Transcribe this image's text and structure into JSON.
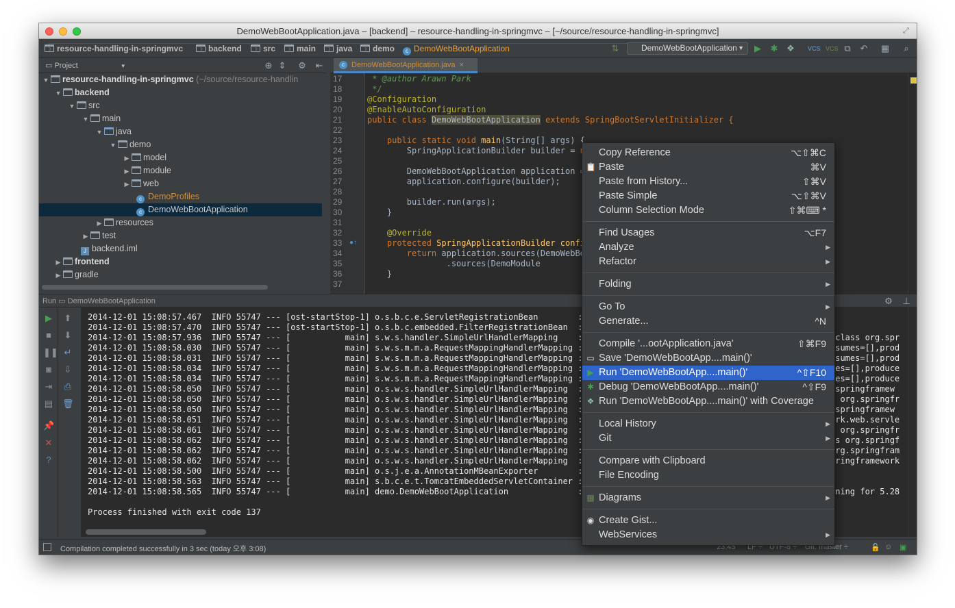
{
  "window": {
    "title": "DemoWebBootApplication.java – [backend] – resource-handling-in-springmvc – [~/source/resource-handling-in-springmvc]"
  },
  "navbar": {
    "breadcrumbs": [
      "resource-handling-in-springmvc",
      "backend",
      "src",
      "main",
      "java",
      "demo",
      "DemoWebBootApplication"
    ],
    "run_config": "DemoWebBootApplication"
  },
  "project": {
    "header_label": "Project",
    "tree": [
      {
        "label": "resource-handling-in-springmvc",
        "suffix": " (~/source/resource-handlin"
      },
      {
        "label": "backend"
      },
      {
        "label": "src"
      },
      {
        "label": "main"
      },
      {
        "label": "java"
      },
      {
        "label": "demo"
      },
      {
        "label": "model"
      },
      {
        "label": "module"
      },
      {
        "label": "web"
      },
      {
        "label": "DemoProfiles"
      },
      {
        "label": "DemoWebBootApplication"
      },
      {
        "label": "resources"
      },
      {
        "label": "test"
      },
      {
        "label": "backend.iml"
      },
      {
        "label": "frontend"
      },
      {
        "label": "gradle"
      }
    ]
  },
  "editor": {
    "tab_label": "DemoWebBootApplication.java",
    "line_numbers": [
      "17",
      "18",
      "19",
      "20",
      "21",
      "22",
      "23",
      "24",
      "25",
      "26",
      "27",
      "28",
      "29",
      "30",
      "31",
      "32",
      "33",
      "34",
      "35",
      "36",
      "37"
    ],
    "lines": {
      "l17": " * @author Arawn Park",
      "l18": " */",
      "l19": "@Configuration",
      "l20": "@EnableAutoConfiguration",
      "l21a": "public class ",
      "l21b": "DemoWebBootApplication",
      "l21c": " extends SpringBootServletInitializer {",
      "l23a": "    public static void ",
      "l23b": "main",
      "l23c": "(String[] args) {",
      "l24a": "        SpringApplicationBuilder builder = ",
      "l24b": "ne",
      "l26": "        DemoWebBootApplication application = ",
      "l27": "        application.configure(builder);",
      "l29": "        builder.run(args);",
      "l30": "    }",
      "l32": "    @Override",
      "l33a": "    protected ",
      "l33b": "SpringApplicationBuilder config",
      "l34a": "        return ",
      "l34b": "application.sources(DemoWebBoo",
      "l35": "                .sources(DemoModule",
      "l36": "    }"
    }
  },
  "run": {
    "header_label": "Run",
    "config_name": "DemoWebBootApplication",
    "log": [
      {
        "left": "2014-12-01 15:08:57.467  INFO 55747 --- [ost-startStop-1] o.s.b.c.e.ServletRegistrationBean        : Ma",
        "right": ""
      },
      {
        "left": "2014-12-01 15:08:57.470  INFO 55747 --- [ost-startStop-1] o.s.b.c.embedded.FilterRegistrationBean  : Ma",
        "right": ""
      },
      {
        "left": "2014-12-01 15:08:57.936  INFO 55747 --- [           main] s.w.s.handler.SimpleUrlHandlerMapping    : Ma",
        "right": "[class org.spr"
      },
      {
        "left": "2014-12-01 15:08:58.030  INFO 55747 --- [           main] s.w.s.m.m.a.RequestMappingHandlerMapping : Ma",
        "right": "nsumes=[],prod"
      },
      {
        "left": "2014-12-01 15:08:58.031  INFO 55747 --- [           main] s.w.s.m.m.a.RequestMappingHandlerMapping : Ma",
        "right": "nsumes=[],prod"
      },
      {
        "left": "2014-12-01 15:08:58.034  INFO 55747 --- [           main] s.w.s.m.m.a.RequestMappingHandlerMapping : Ma",
        "right": "mes=[],produce"
      },
      {
        "left": "2014-12-01 15:08:58.034  INFO 55747 --- [           main] s.w.s.m.m.a.RequestMappingHandlerMapping : Ma",
        "right": "mes=[],produce"
      },
      {
        "left": "2014-12-01 15:08:58.050  INFO 55747 --- [           main] o.s.w.s.handler.SimpleUrlHandlerMapping  : Ma",
        "right": ".springframew"
      },
      {
        "left": "2014-12-01 15:08:58.050  INFO 55747 --- [           main] o.s.w.s.handler.SimpleUrlHandlerMapping  : Ma",
        "right": "s org.springfr"
      },
      {
        "left": "2014-12-01 15:08:58.050  INFO 55747 --- [           main] o.s.w.s.handler.SimpleUrlHandlerMapping  : Ma",
        "right": ".springframew"
      },
      {
        "left": "2014-12-01 15:08:58.051  INFO 55747 --- [           main] o.s.w.s.handler.SimpleUrlHandlerMapping  : Ro",
        "right": "ork.web.servle"
      },
      {
        "left": "2014-12-01 15:08:58.061  INFO 55747 --- [           main] o.s.w.s.handler.SimpleUrlHandlerMapping  : Ma",
        "right": "s org.springfr"
      },
      {
        "left": "2014-12-01 15:08:58.062  INFO 55747 --- [           main] o.s.w.s.handler.SimpleUrlHandlerMapping  : Ma",
        "right": "ss org.springf"
      },
      {
        "left": "2014-12-01 15:08:58.062  INFO 55747 --- [           main] o.s.w.s.handler.SimpleUrlHandlerMapping  : Ma",
        "right": "org.springfram"
      },
      {
        "left": "2014-12-01 15:08:58.062  INFO 55747 --- [           main] o.s.w.s.handler.SimpleUrlHandlerMapping  : Ma",
        "right": "pringframework"
      },
      {
        "left": "2014-12-01 15:08:58.500  INFO 55747 --- [           main] o.s.j.e.a.AnnotationMBeanExporter        : Re",
        "right": ""
      },
      {
        "left": "2014-12-01 15:08:58.563  INFO 55747 --- [           main] s.b.c.e.t.TomcatEmbeddedServletContainer : To",
        "right": ""
      },
      {
        "left": "2014-12-01 15:08:58.565  INFO 55747 --- [           main] demo.DemoWebBootApplication              : St",
        "right": "nning for 5.28"
      }
    ],
    "exit_message": "Process finished with exit code 137"
  },
  "status": {
    "message": "Compilation completed successfully in 3 sec (today 오후 3:08)",
    "position": "23:45",
    "line_sep": "LF ÷",
    "encoding": "UTF-8 ÷",
    "vcs": "Git: master ÷"
  },
  "context_menu": {
    "items": [
      {
        "label": "Copy Reference",
        "shortcut": "⌥⇧⌘C"
      },
      {
        "label": "Paste",
        "shortcut": "⌘V"
      },
      {
        "label": "Paste from History...",
        "shortcut": "⇧⌘V"
      },
      {
        "label": "Paste Simple",
        "shortcut": "⌥⇧⌘V"
      },
      {
        "label": "Column Selection Mode",
        "shortcut": "⇧⌘⌨ *"
      },
      {
        "label": "Find Usages",
        "shortcut": "⌥F7"
      },
      {
        "label": "Analyze",
        "shortcut": ""
      },
      {
        "label": "Refactor",
        "shortcut": ""
      },
      {
        "label": "Folding",
        "shortcut": ""
      },
      {
        "label": "Go To",
        "shortcut": ""
      },
      {
        "label": "Generate...",
        "shortcut": "^N"
      },
      {
        "label": "Compile '...ootApplication.java'",
        "shortcut": "⇧⌘F9"
      },
      {
        "label": "Save 'DemoWebBootApp....main()'",
        "shortcut": ""
      },
      {
        "label": "Run 'DemoWebBootApp....main()'",
        "shortcut": "^⇧F10"
      },
      {
        "label": "Debug 'DemoWebBootApp....main()'",
        "shortcut": "^⇧F9"
      },
      {
        "label": "Run 'DemoWebBootApp....main()' with Coverage",
        "shortcut": ""
      },
      {
        "label": "Local History",
        "shortcut": ""
      },
      {
        "label": "Git",
        "shortcut": ""
      },
      {
        "label": "Compare with Clipboard",
        "shortcut": ""
      },
      {
        "label": "File Encoding",
        "shortcut": ""
      },
      {
        "label": "Diagrams",
        "shortcut": ""
      },
      {
        "label": "Create Gist...",
        "shortcut": ""
      },
      {
        "label": "WebServices",
        "shortcut": ""
      }
    ]
  },
  "colors": {
    "menu_highlight": "#2f65ca",
    "editor_bg": "#2b2b2b",
    "panel_bg": "#3c3f41",
    "selected_row": "#0d293e",
    "keyword": "#cc7832",
    "annotation": "#bbb529",
    "run_green": "#499c54"
  },
  "icons": [
    "folder-icon",
    "class-icon",
    "run-icon",
    "debug-icon",
    "stop-icon",
    "pause-icon",
    "gear-icon",
    "search-icon",
    "close-icon",
    "help-icon",
    "paste-icon",
    "save-icon",
    "gist-icon",
    "diagram-icon",
    "coverage-icon"
  ]
}
